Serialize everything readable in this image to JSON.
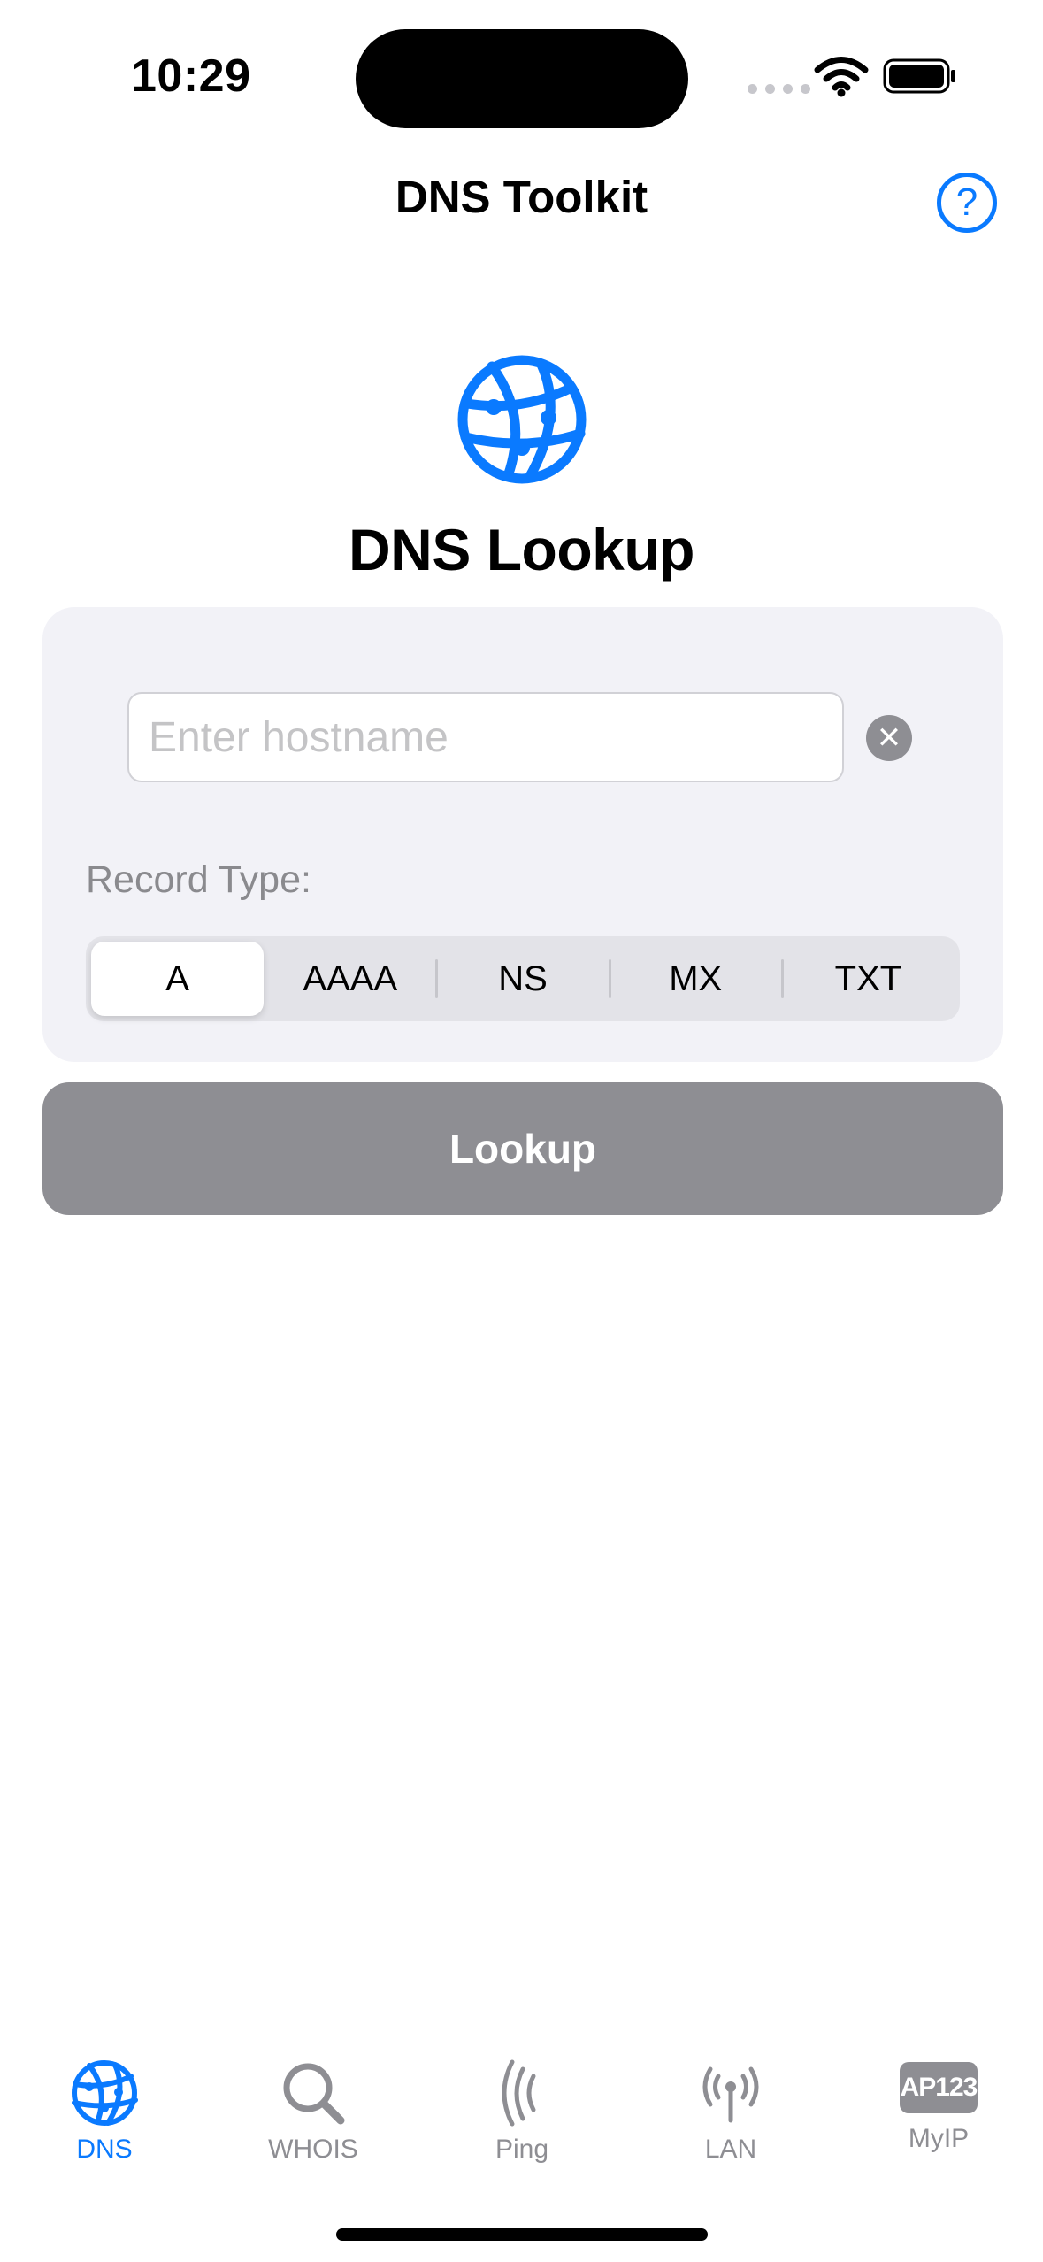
{
  "status_bar": {
    "time": "10:29"
  },
  "nav": {
    "title": "DNS Toolkit",
    "help_label": "?"
  },
  "hero": {
    "heading": "DNS Lookup"
  },
  "form": {
    "hostname_placeholder": "Enter hostname",
    "hostname_value": "",
    "clear_label": "✕",
    "record_type_label": "Record Type:",
    "record_types": [
      "A",
      "AAAA",
      "NS",
      "MX",
      "TXT"
    ],
    "selected_record_type": "A"
  },
  "lookup_button": {
    "label": "Lookup"
  },
  "tabbar": {
    "tabs": [
      {
        "label": "DNS",
        "icon": "globe-icon",
        "active": true
      },
      {
        "label": "WHOIS",
        "icon": "magnifying-glass-icon",
        "active": false
      },
      {
        "label": "Ping",
        "icon": "ping-waves-icon",
        "active": false
      },
      {
        "label": "LAN",
        "icon": "antenna-icon",
        "active": false
      },
      {
        "label": "MyIP",
        "icon": "ip-badge-icon",
        "badge_text": "AP123",
        "active": false
      }
    ]
  },
  "colors": {
    "accent": "#0a7aff",
    "inactive": "#8e8e93",
    "card_bg": "#f2f2f7",
    "button_disabled": "#8e8e93"
  }
}
